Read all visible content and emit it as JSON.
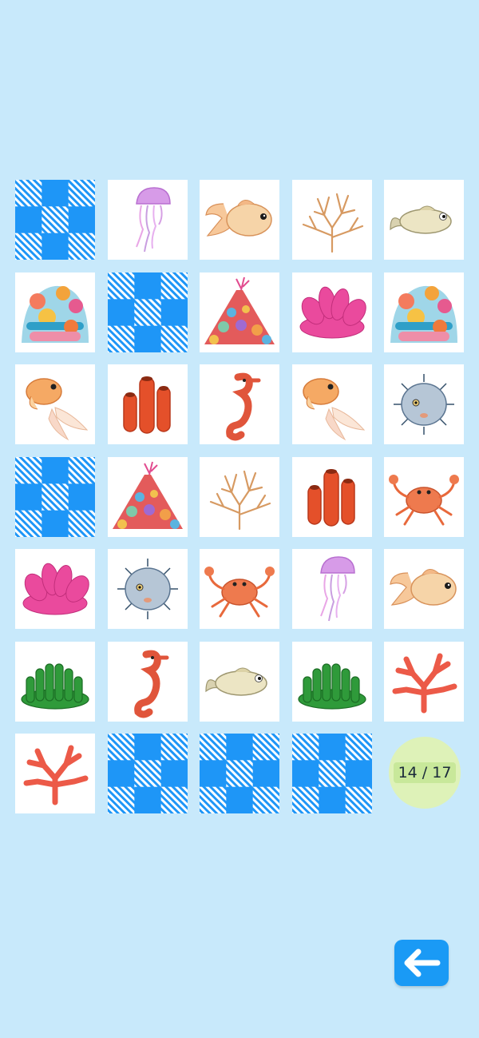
{
  "game": {
    "counter_text": "14 / 17",
    "back_icon": "arrow-left-icon",
    "colors": {
      "background": "#c8e9fb",
      "card_back": "#1e96f7",
      "counter_bg": "#def2b8",
      "back_button": "#1a9af5"
    }
  },
  "tiles": [
    "hidden",
    "jellyfish",
    "goldfish",
    "branch-coral",
    "pale-fish",
    "reef",
    "hidden",
    "coral-mound",
    "pink-anemone",
    "reef",
    "fantail-goldfish",
    "tube-sponge",
    "seahorse",
    "fantail-goldfish",
    "pufferfish",
    "hidden",
    "coral-mound",
    "branch-coral",
    "tube-sponge",
    "crab",
    "pink-anemone",
    "pufferfish",
    "crab",
    "jellyfish",
    "goldfish",
    "green-seaweed",
    "seahorse",
    "pale-fish",
    "green-seaweed",
    "red-coral",
    "red-coral",
    "hidden",
    "hidden",
    "hidden"
  ]
}
